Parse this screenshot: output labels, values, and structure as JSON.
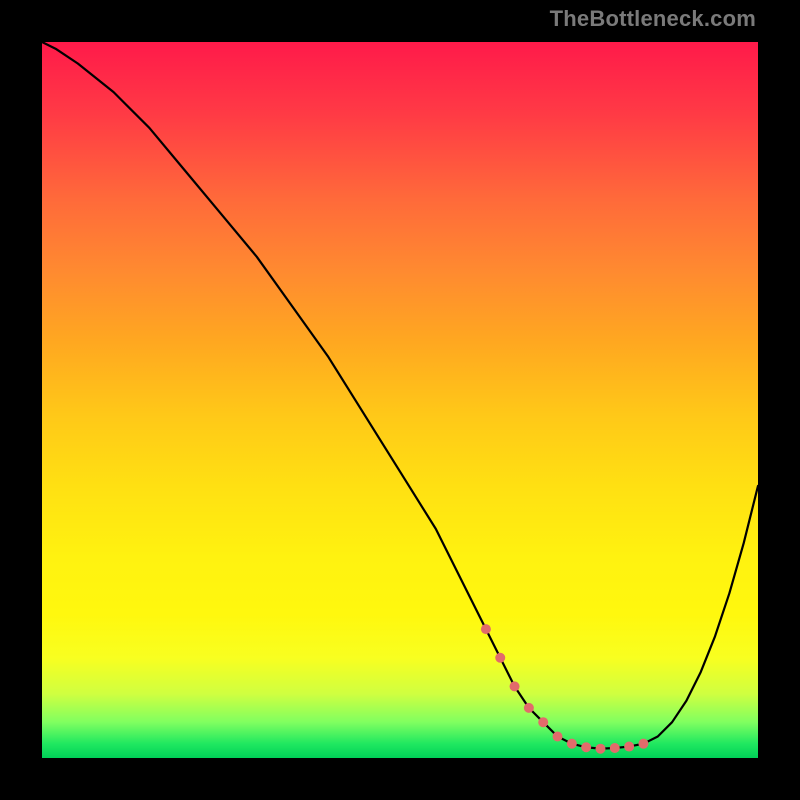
{
  "watermark": "TheBottleneck.com",
  "chart_data": {
    "type": "line",
    "title": "",
    "xlabel": "",
    "ylabel": "",
    "xlim": [
      0,
      100
    ],
    "ylim": [
      0,
      100
    ],
    "grid": false,
    "series": [
      {
        "name": "curve",
        "x": [
          0,
          2,
          5,
          10,
          15,
          20,
          25,
          30,
          35,
          40,
          45,
          50,
          55,
          60,
          62,
          64,
          66,
          68,
          70,
          72,
          74,
          76,
          78,
          80,
          82,
          84,
          86,
          88,
          90,
          92,
          94,
          96,
          98,
          100
        ],
        "values": [
          100,
          99,
          97,
          93,
          88,
          82,
          76,
          70,
          63,
          56,
          48,
          40,
          32,
          22,
          18,
          14,
          10,
          7,
          5,
          3,
          2,
          1.5,
          1.3,
          1.4,
          1.6,
          2,
          3,
          5,
          8,
          12,
          17,
          23,
          30,
          38
        ]
      }
    ],
    "dots": {
      "x": [
        62,
        64,
        66,
        68,
        70,
        72,
        74,
        76,
        78,
        80,
        82,
        84
      ],
      "values": [
        18,
        14,
        10,
        7,
        5,
        3,
        2,
        1.5,
        1.3,
        1.4,
        1.6,
        2
      ],
      "color": "#e26b6b"
    },
    "colors": {
      "line": "#000000",
      "dot": "#e26b6b",
      "background_top": "#ff1a4a",
      "background_bottom": "#00d058"
    }
  }
}
